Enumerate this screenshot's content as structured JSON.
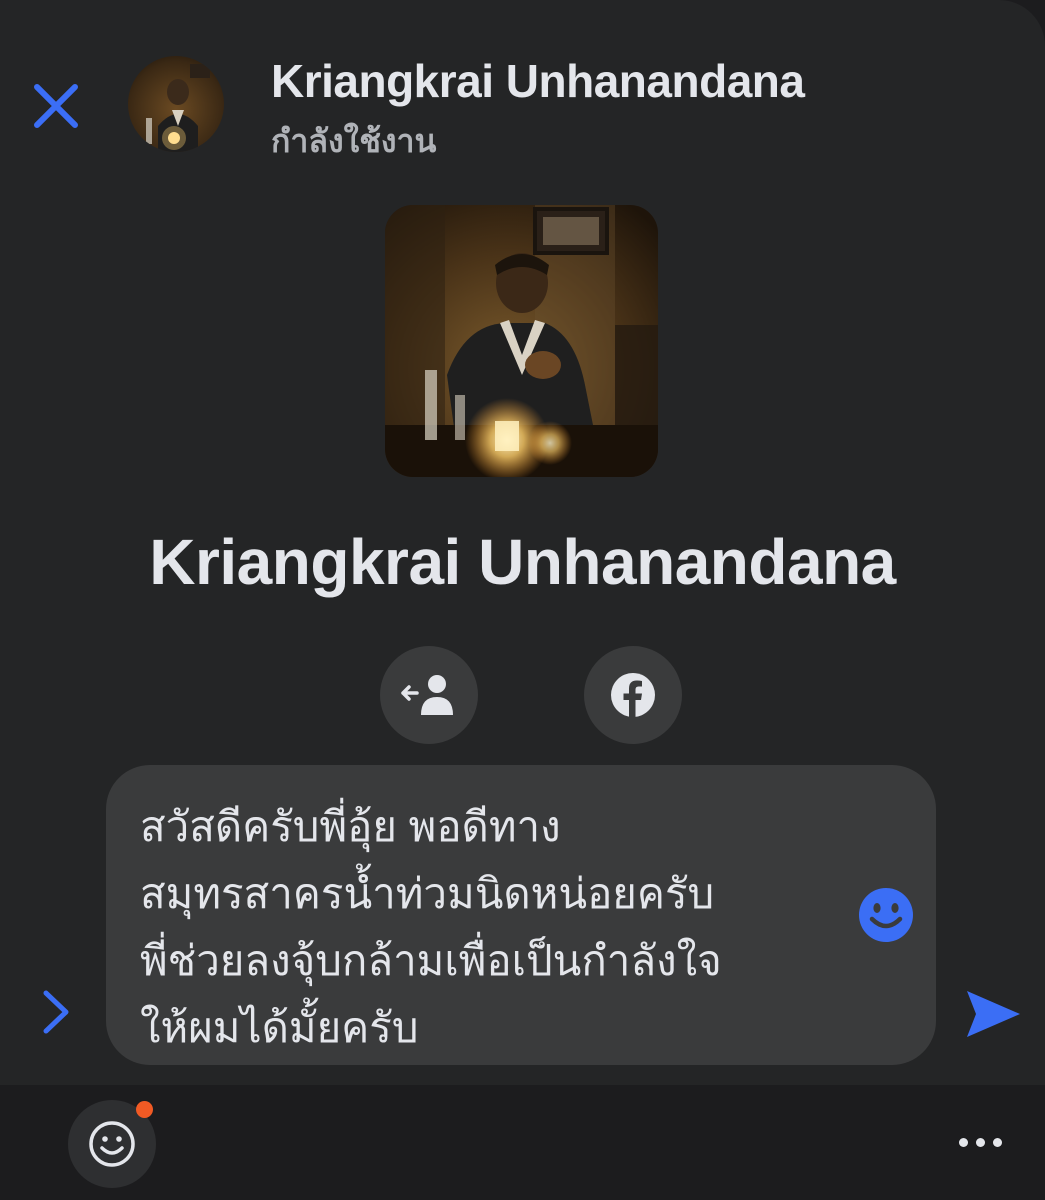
{
  "header": {
    "name": "Kriangkrai Unhanandana",
    "status": "กำลังใช้งาน",
    "close_icon": "close-icon"
  },
  "profile": {
    "name": "Kriangkrai Unhanandana",
    "actions": [
      {
        "icon": "exit-profile-icon"
      },
      {
        "icon": "facebook-icon"
      }
    ]
  },
  "composer": {
    "text": "สวัสดีครับพี่อุ้ย พอดีทาง\nสมุทรสาครน้ำท่วมนิดหน่อยครับ\nพี่ช่วยลงจุ้บกล้ามเพื่อเป็นกำลังใจ\nให้ผมได้มั้ยครับ",
    "emoji_icon": "smiley-icon",
    "send_icon": "send-icon",
    "expand_icon": "chevron-right-icon"
  },
  "bottom_bar": {
    "emoji_icon": "smiley-outline-icon",
    "more_icon": "more-icon"
  },
  "colors": {
    "accent": "#3b6ef5",
    "panel_bg": "#242526",
    "page_bg": "#1c1c1e",
    "input_bg": "#3a3b3c",
    "notification_dot": "#f15a24"
  }
}
